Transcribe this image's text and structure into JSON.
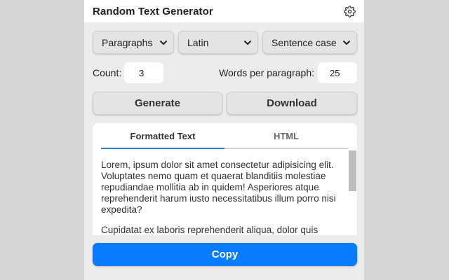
{
  "app": {
    "title": "Random Text Generator",
    "settings_icon": "gear-icon"
  },
  "options": {
    "type_selected": "Paragraphs",
    "language_selected": "Latin",
    "case_selected": "Sentence case"
  },
  "counts": {
    "count_label": "Count:",
    "count_value": "3",
    "words_label": "Words per paragraph:",
    "words_value": "25"
  },
  "actions": {
    "generate_label": "Generate",
    "download_label": "Download"
  },
  "tabs": [
    {
      "label": "Formatted Text",
      "active": true
    },
    {
      "label": "HTML",
      "active": false
    }
  ],
  "output": {
    "paragraphs": [
      "Lorem, ipsum dolor sit amet consectetur adipisicing elit. Voluptates nemo quam et quaerat blanditiis molestiae repudiandae mollitia ab in quidem! Asperiores atque reprehenderit harum iusto necessitatibus illum porro nisi expedita?",
      "Cupidatat ex laboris reprehenderit aliqua, dolor quis"
    ]
  },
  "copy_label": "Copy",
  "colors": {
    "accent": "#0a7cff",
    "tab_underline": "#2b7bd6",
    "panel_bg": "#ececec"
  }
}
